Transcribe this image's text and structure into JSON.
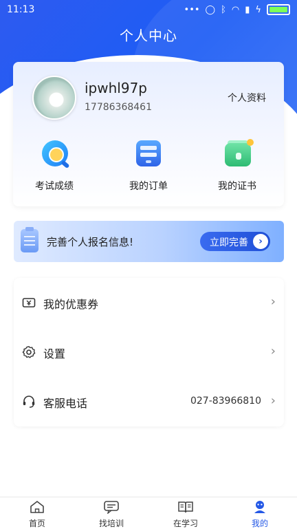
{
  "status_bar": {
    "time": "11:13",
    "icons": [
      "more-icon",
      "alarm-icon",
      "bluetooth-icon",
      "wifi-icon",
      "signal-icon",
      "charging-icon",
      "battery-icon"
    ]
  },
  "header": {
    "title": "个人中心"
  },
  "profile": {
    "username": "ipwhl97p",
    "phone": "17786368461",
    "profile_link": "个人资料"
  },
  "quick_actions": [
    {
      "label": "考试成绩",
      "icon": "exam-score-icon"
    },
    {
      "label": "我的订单",
      "icon": "order-icon"
    },
    {
      "label": "我的证书",
      "icon": "certificate-icon"
    }
  ],
  "banner": {
    "text": "完善个人报名信息!",
    "button_label": "立即完善"
  },
  "menu": [
    {
      "label": "我的优惠券",
      "icon": "coupon-icon",
      "value": ""
    },
    {
      "label": "设置",
      "icon": "gear-icon",
      "value": ""
    },
    {
      "label": "客服电话",
      "icon": "headset-icon",
      "value": "027-83966810"
    }
  ],
  "tabs": [
    {
      "label": "首页",
      "icon": "home-icon"
    },
    {
      "label": "找培训",
      "icon": "message-icon"
    },
    {
      "label": "在学习",
      "icon": "book-icon"
    },
    {
      "label": "我的",
      "icon": "user-icon",
      "active": true
    }
  ],
  "colors": {
    "primary": "#2458e6",
    "banner_button": "#1f4fd6",
    "text": "#222222"
  }
}
